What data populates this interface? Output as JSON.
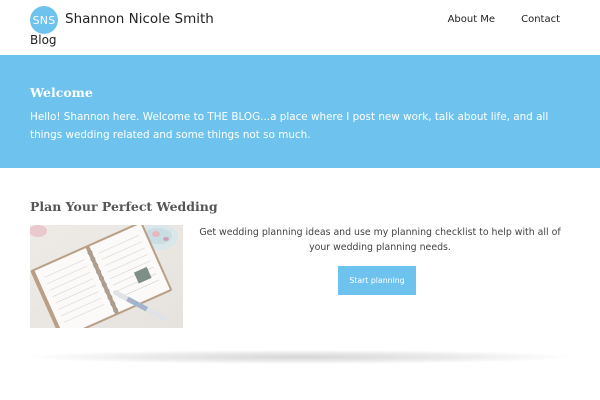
{
  "header": {
    "logo_initials": "SNS",
    "site_name": "Shannon Nicole Smith",
    "tagline": "Blog",
    "nav": [
      {
        "label": "About Me"
      },
      {
        "label": "Contact"
      }
    ]
  },
  "welcome": {
    "title": "Welcome",
    "text": "Hello! Shannon here. Welcome to THE BLOG...a place where I post new work, talk about life, and all things wedding related and some things not so much."
  },
  "plan": {
    "title": "Plan Your Perfect Wedding",
    "description": "Get wedding planning ideas and use my planning checklist to help with all of your wedding planning needs.",
    "cta_label": "Start planning"
  },
  "colors": {
    "accent": "#6ec3ee",
    "text_dark": "#222222",
    "white": "#ffffff"
  }
}
